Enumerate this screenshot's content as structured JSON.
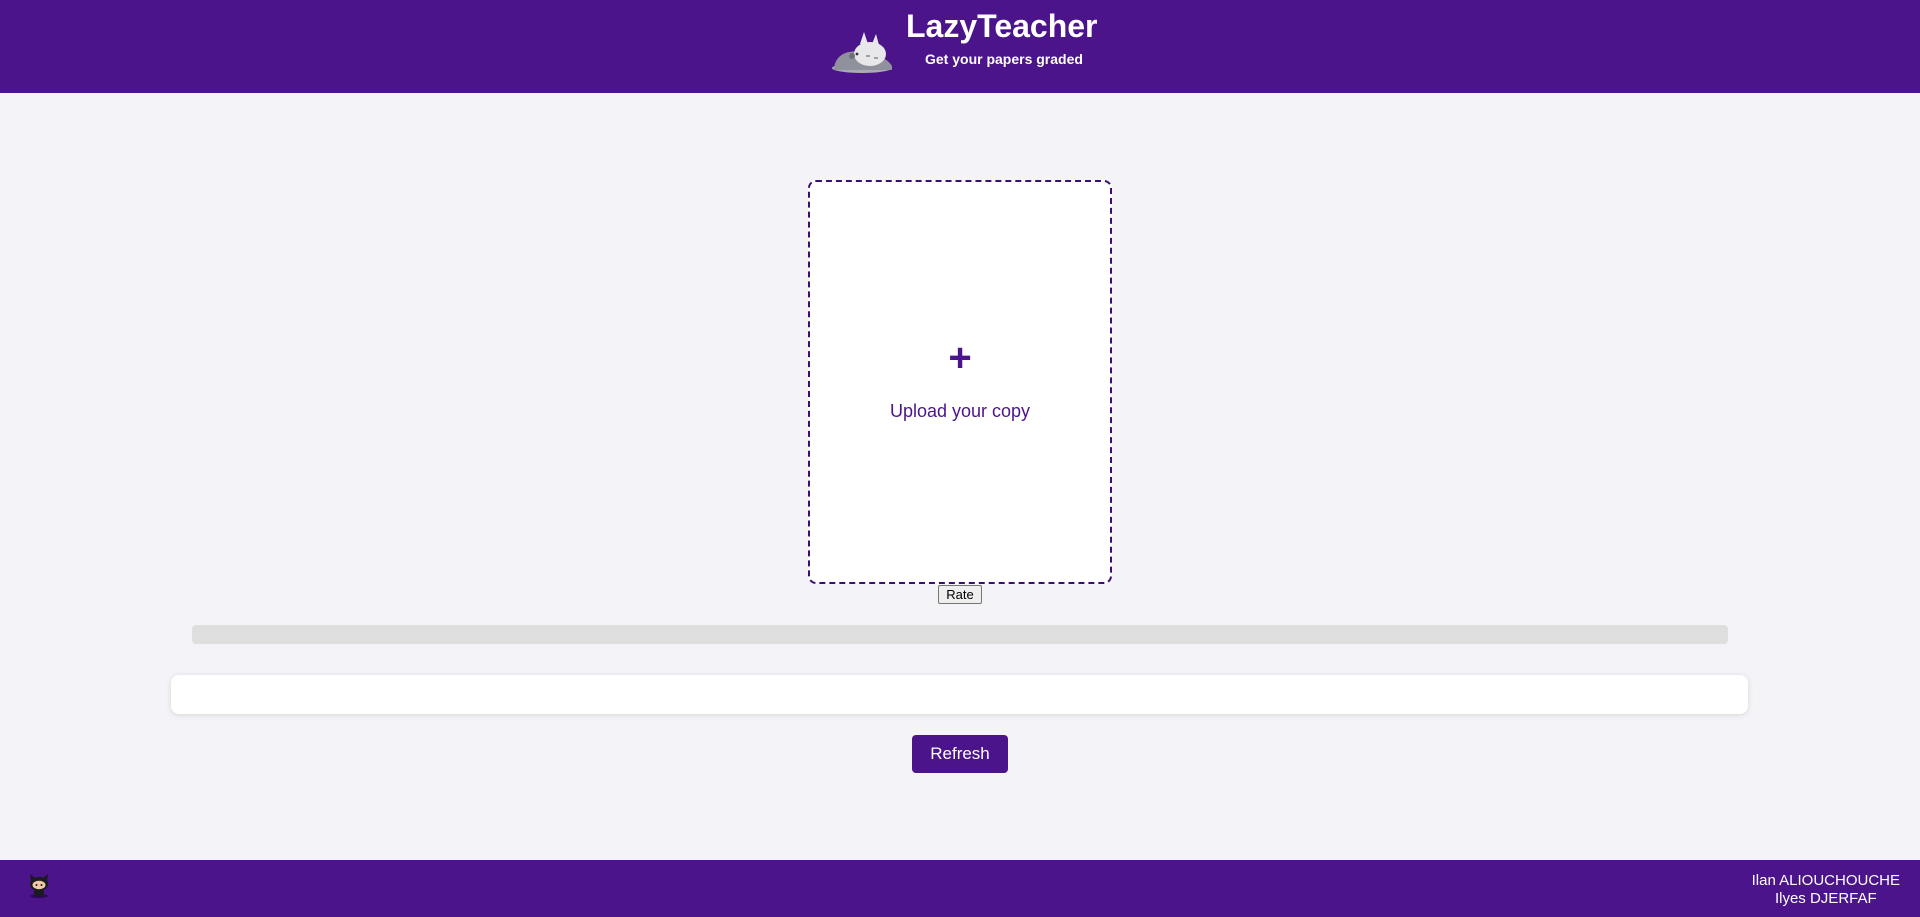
{
  "header": {
    "title": "LazyTeacher",
    "subtitle": "Get your papers graded",
    "logo_icon": "sleeping-totoro-logo-icon"
  },
  "upload": {
    "plus_symbol": "+",
    "label": "Upload your copy"
  },
  "actions": {
    "rate_label": "Rate",
    "refresh_label": "Refresh"
  },
  "progress": {
    "value_percent": 0
  },
  "result": {
    "text": ""
  },
  "footer": {
    "github_icon": "github-icon",
    "authors": [
      "Ilan ALIOUCHOUCHE",
      "Ilyes DJERFAF"
    ]
  },
  "colors": {
    "brand_purple": "#4b148b",
    "background": "#f4f3f8",
    "progress_track": "#dedede"
  }
}
